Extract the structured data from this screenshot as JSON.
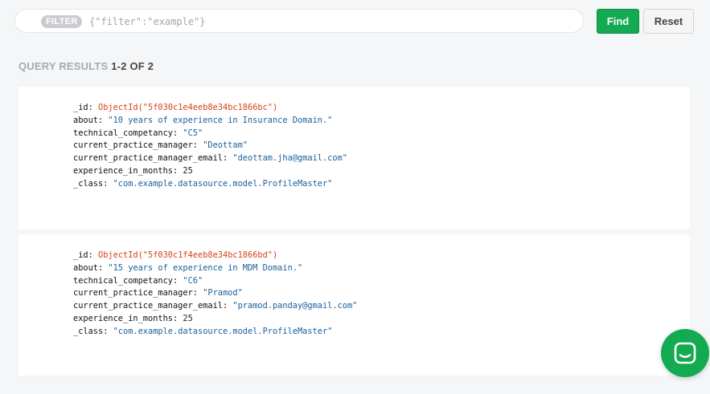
{
  "toolbar": {
    "filter_badge": "FILTER",
    "filter_placeholder": "{\"filter\":\"example\"}",
    "find_label": "Find",
    "reset_label": "Reset"
  },
  "results": {
    "label": "QUERY RESULTS",
    "count": "1-2 OF 2"
  },
  "documents": [
    {
      "_id": "ObjectId(\"5f030c1e4eeb8e34bc1866bc\")",
      "about": "\"10 years of experience in Insurance Domain.\"",
      "technical_competancy": "\"C5\"",
      "current_practice_manager": "\"Deottam\"",
      "current_practice_manager_email": "\"deottam.jha@gmail.com\"",
      "experience_in_months": "25",
      "_class": "\"com.example.datasource.model.ProfileMaster\""
    },
    {
      "_id": "ObjectId(\"5f030c1f4eeb8e34bc1866bd\")",
      "about": "\"15 years of experience in MDM Domain.\"",
      "technical_competancy": "\"C6\"",
      "current_practice_manager": "\"Pramod\"",
      "current_practice_manager_email": "\"pramod.panday@gmail.com\"",
      "experience_in_months": "25",
      "_class": "\"com.example.datasource.model.ProfileMaster\""
    }
  ],
  "field_keys": {
    "id": "_id:",
    "about": "about:",
    "technical_competancy": "technical_competancy:",
    "current_practice_manager": "current_practice_manager:",
    "current_practice_manager_email": "current_practice_manager_email:",
    "experience_in_months": "experience_in_months:",
    "class": "_class:"
  },
  "colors": {
    "accent_green": "#13aa52",
    "objectid": "#d64218",
    "string_value": "#1a5f9b"
  },
  "chat_widget": {
    "icon": "chat-bubble-icon"
  }
}
